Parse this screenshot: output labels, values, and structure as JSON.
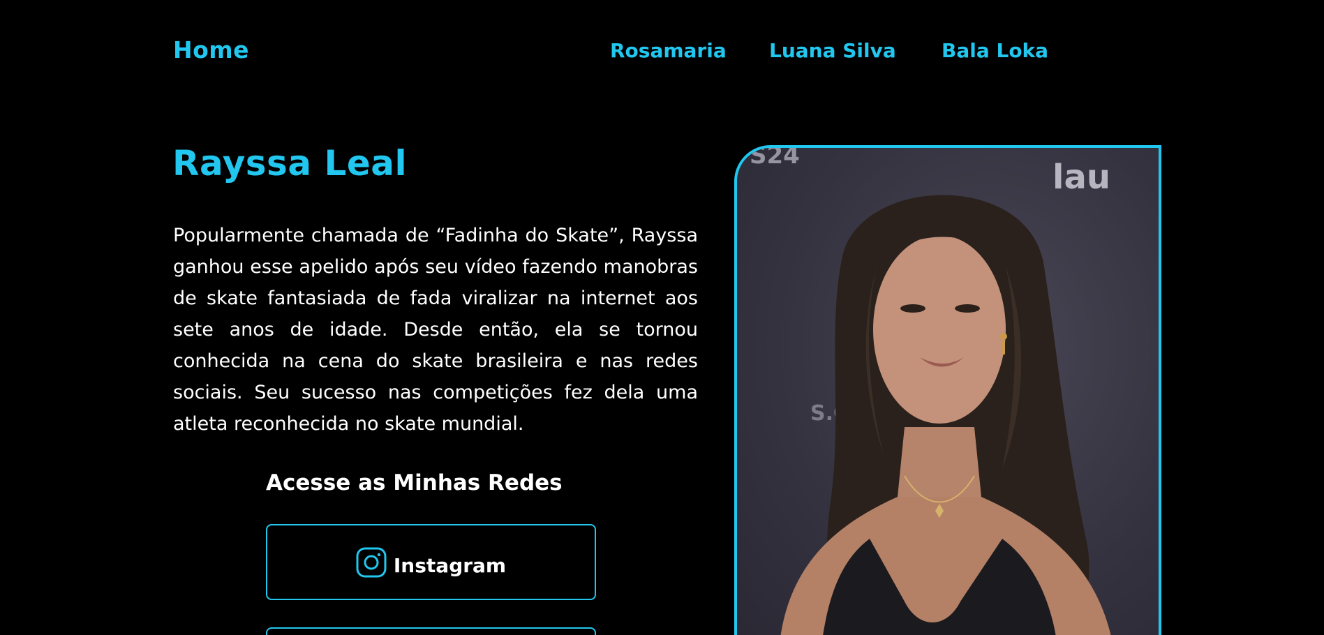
{
  "nav": {
    "home": "Home",
    "links": [
      "Rosamaria",
      "Luana Silva",
      "Bala Loka"
    ]
  },
  "profile": {
    "name": "Rayssa Leal",
    "bio": "Popularmente chamada de “Fadinha do Skate”, Rayssa ganhou esse apelido após seu vídeo fazendo manobras de skate fantasiada de fada viralizar na internet aos sete anos de idade. Desde então, ela se tornou conhecida na cena do skate brasileira e nas redes sociais. Seu sucesso nas competições fez dela uma atleta reconhecida no skate mundial."
  },
  "social": {
    "heading": "Acesse as Minhas Redes",
    "buttons": [
      {
        "label": "Instagram",
        "icon": "instagram-icon"
      },
      {
        "label": "",
        "icon": ""
      }
    ]
  },
  "photo": {
    "icon": "portrait-photo",
    "wall_text": [
      "S24",
      "lau",
      "S.C"
    ]
  },
  "colors": {
    "accent": "#22c7ef",
    "background": "#000000",
    "text": "#ffffff"
  }
}
